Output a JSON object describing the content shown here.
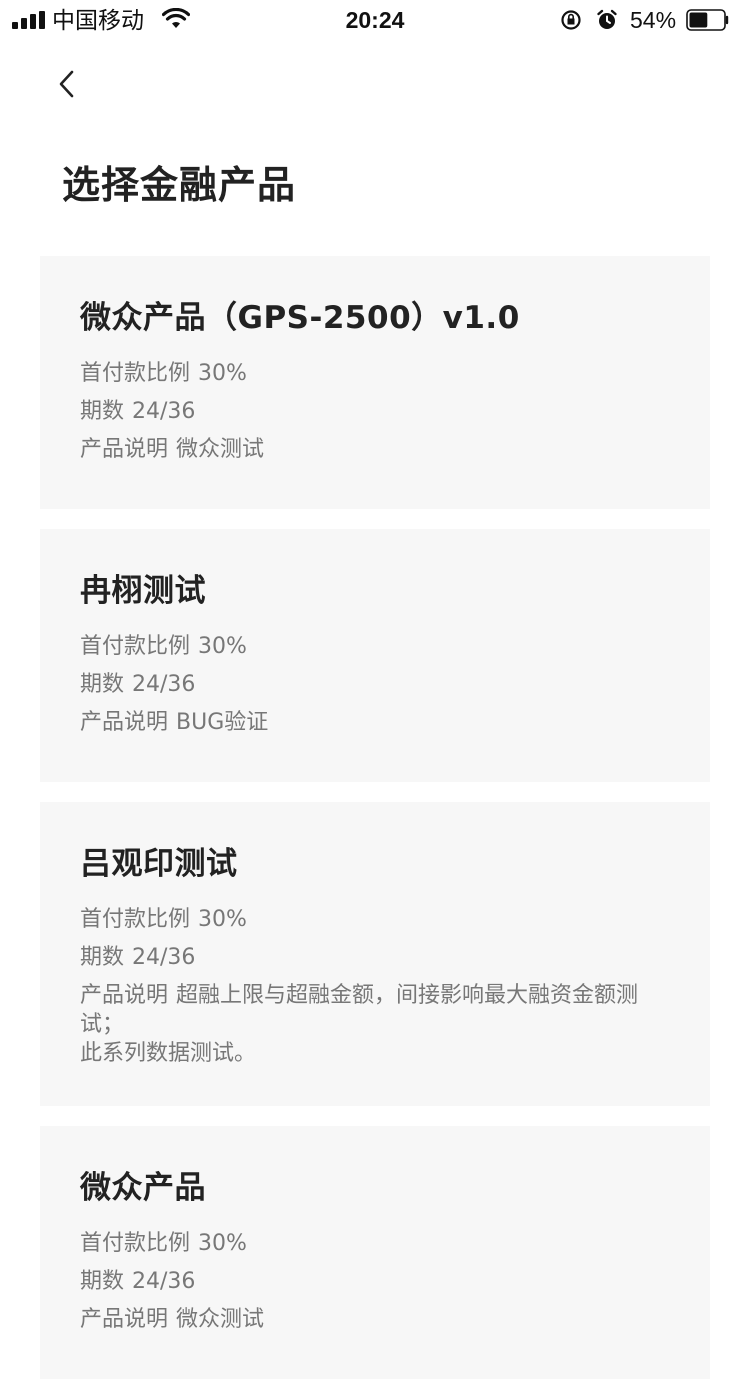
{
  "status_bar": {
    "carrier": "中国移动",
    "time": "20:24",
    "battery_percent": "54%",
    "battery_level": 0.54,
    "icons": [
      "signal-icon",
      "wifi-icon",
      "rotation-lock-icon",
      "alarm-icon",
      "battery-icon"
    ]
  },
  "nav": {
    "back_icon": "chevron-left-icon"
  },
  "page_title": "选择金融产品",
  "labels": {
    "down_payment": "首付款比例",
    "terms": "期数",
    "description": "产品说明"
  },
  "products": [
    {
      "name": "微众产品（GPS-2500）v1.0",
      "down_payment": "30%",
      "terms": "24/36",
      "description": "微众测试"
    },
    {
      "name": "冉栩测试",
      "down_payment": "30%",
      "terms": "24/36",
      "description": "BUG验证"
    },
    {
      "name": "吕观印测试",
      "down_payment": "30%",
      "terms": "24/36",
      "description": "超融上限与超融金额，间接影响最大融资金额测试；\n此系列数据测试。"
    },
    {
      "name": "微众产品",
      "down_payment": "30%",
      "terms": "24/36",
      "description": "微众测试"
    }
  ]
}
